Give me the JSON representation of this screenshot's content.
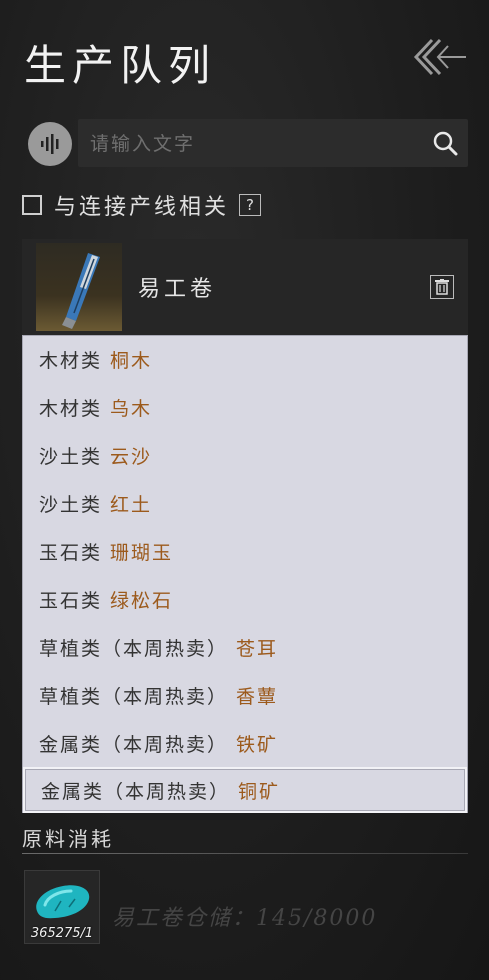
{
  "header": {
    "title": "生产队列"
  },
  "search": {
    "placeholder": "请输入文字"
  },
  "filter": {
    "checkbox_label": "与连接产线相关",
    "checked": false,
    "help_label": "?"
  },
  "queue_item": {
    "name": "易工卷"
  },
  "dropdown": {
    "options": [
      {
        "category": "木材类",
        "value": "桐木"
      },
      {
        "category": "木材类",
        "value": "乌木"
      },
      {
        "category": "沙土类",
        "value": "云沙"
      },
      {
        "category": "沙土类",
        "value": "红土"
      },
      {
        "category": "玉石类",
        "value": "珊瑚玉"
      },
      {
        "category": "玉石类",
        "value": "绿松石"
      },
      {
        "category": "草植类（本周热卖）",
        "value": "苍耳"
      },
      {
        "category": "草植类（本周热卖）",
        "value": "香蕈"
      },
      {
        "category": "金属类（本周热卖）",
        "value": "铁矿"
      },
      {
        "category": "金属类（本周热卖）",
        "value": "铜矿"
      }
    ],
    "selected_index": 9
  },
  "materials": {
    "section_title": "原料消耗",
    "items": [
      {
        "icon": "turquoise-stone-icon",
        "count": "365275/1"
      }
    ],
    "capacity_text": "易工卷仓储：145/8000"
  },
  "colors": {
    "background": "#1d1d1d",
    "dropdown_bg": "#d8d8e2",
    "accent_value": "#9c5a1c"
  }
}
